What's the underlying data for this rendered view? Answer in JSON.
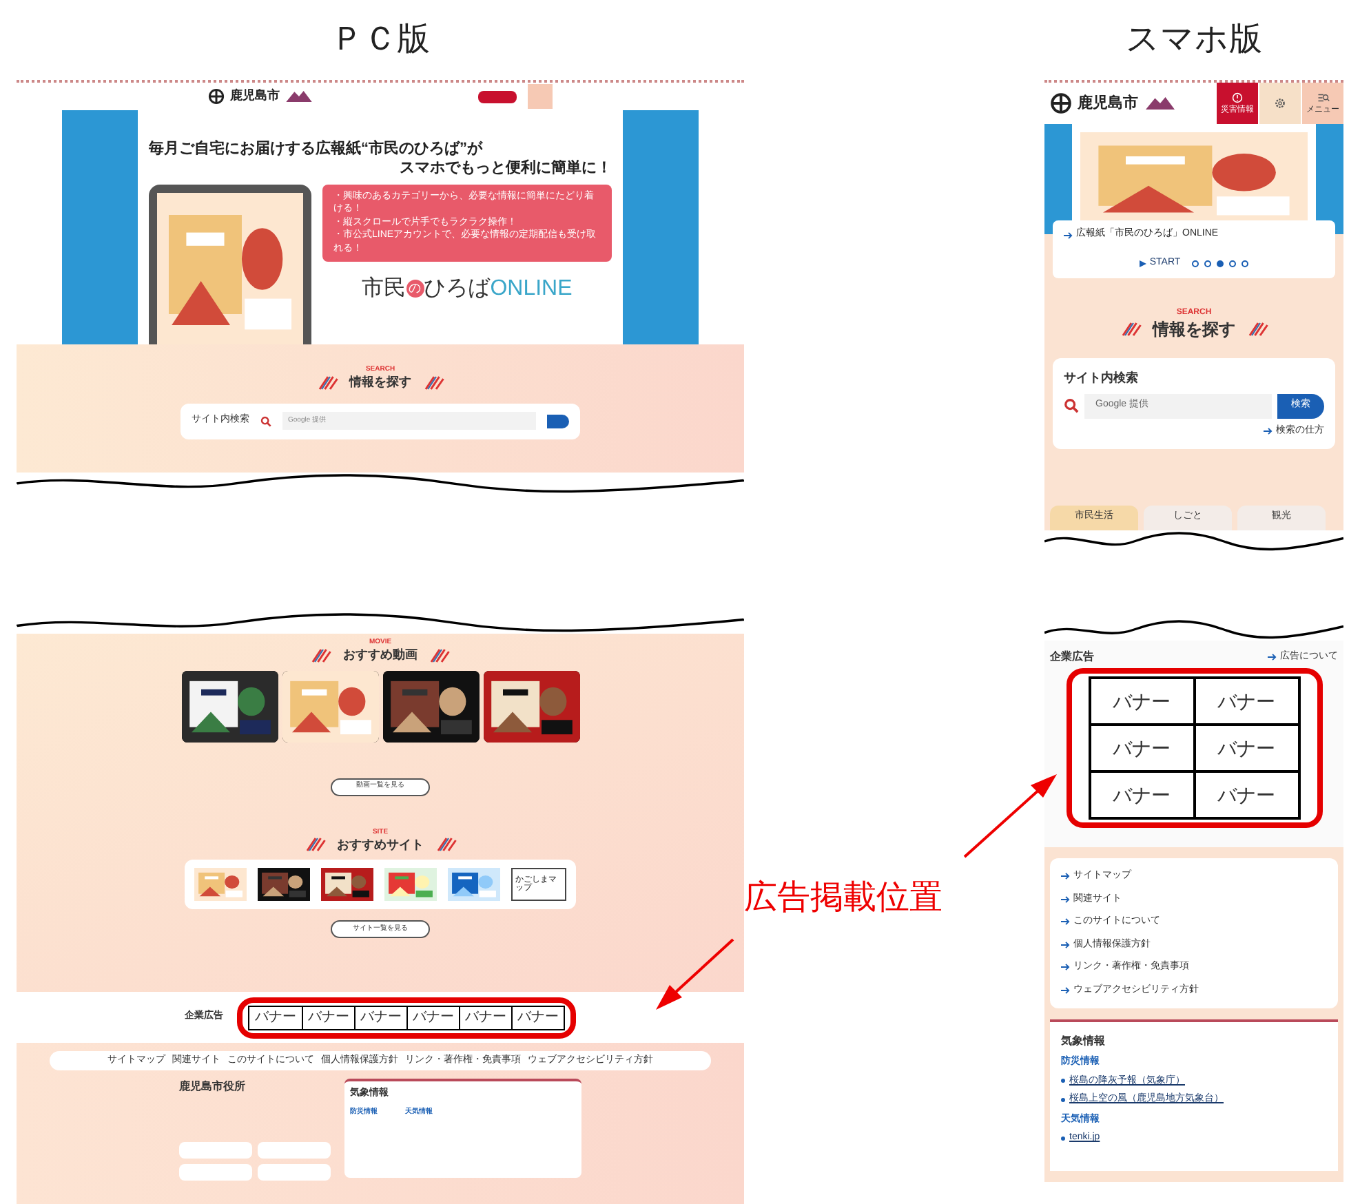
{
  "pc": {
    "label": "ＰＣ版",
    "header": {
      "logo": "鹿児島市"
    },
    "hero": {
      "headline": [
        "毎月ご自宅にお届けする広報紙“市民のひろば”が",
        "スマホでもっと便利に簡単に！"
      ],
      "bullets": [
        "・興味のあるカテゴリーから、必要な情報に簡単にたどり着ける！",
        "・縦スクロールで片手でもラクラク操作！",
        "・市公式LINEアカウントで、必要な情報の定期配信も受け取れる！"
      ],
      "brand": {
        "main": "市民",
        "circle": "の",
        "rest": "ひろば",
        "suffix": "ONLINE"
      }
    },
    "search": {
      "eyebrow": "SEARCH",
      "title": "情報を探す",
      "card_title": "サイト内検索",
      "placeholder": "Google 提供"
    },
    "movies": {
      "eyebrow": "MOVIE",
      "title": "おすすめ動画",
      "thumbnails": [
        {
          "kind": "picture"
        },
        {
          "kind": "picture"
        },
        {
          "kind": "picture"
        },
        {
          "kind": "picture"
        }
      ],
      "more": "動画一覧を見る"
    },
    "sites": {
      "eyebrow": "SITE",
      "title": "おすすめサイト",
      "banners": [
        {
          "kind": "picture"
        },
        {
          "kind": "picture"
        },
        {
          "kind": "picture"
        },
        {
          "kind": "picture"
        },
        {
          "kind": "picture"
        },
        {
          "kind": "map",
          "label": "かごしまマップ"
        }
      ],
      "more": "サイト一覧を見る"
    },
    "ads": {
      "title": "企業広告",
      "slots": [
        "バナー",
        "バナー",
        "バナー",
        "バナー",
        "バナー",
        "バナー"
      ]
    },
    "footer": {
      "links": [
        "サイトマップ",
        "関連サイト",
        "このサイトについて",
        "個人情報保護方針",
        "リンク・著作権・免責事項",
        "ウェブアクセシビリティ方針"
      ],
      "office": "鹿児島市役所",
      "weather": {
        "title": "気象情報",
        "sections": [
          "防災情報",
          "天気情報"
        ]
      }
    }
  },
  "phone": {
    "label": "スマホ版",
    "header": {
      "logo": "鹿児島市",
      "buttons": [
        {
          "kind": "alert",
          "label": "災害情報"
        },
        {
          "kind": "globe"
        },
        {
          "kind": "menu",
          "label": "メニュー"
        }
      ]
    },
    "hero": {
      "link": "広報紙「市民のひろば」ONLINE",
      "start": "START",
      "dots": [
        {
          "selected": false
        },
        {
          "selected": false
        },
        {
          "selected": true
        },
        {
          "selected": false
        },
        {
          "selected": false
        }
      ]
    },
    "search": {
      "eyebrow": "SEARCH",
      "title": "情報を探す",
      "card_title": "サイト内検索",
      "placeholder": "Google 提供",
      "button": "検索",
      "help": "検索の仕方"
    },
    "tabs": [
      {
        "label": "市民生活",
        "selected": true
      },
      {
        "label": "しごと",
        "selected": false
      },
      {
        "label": "観光",
        "selected": false
      }
    ],
    "ads": {
      "title": "企業広告",
      "about": "広告について",
      "slots": [
        "バナー",
        "バナー",
        "バナー",
        "バナー",
        "バナー",
        "バナー"
      ]
    },
    "footer": {
      "links": [
        "サイトマップ",
        "関連サイト",
        "このサイトについて",
        "個人情報保護方針",
        "リンク・著作権・免責事項",
        "ウェブアクセシビリティ方針"
      ]
    },
    "weather": {
      "title": "気象情報",
      "sections": [
        {
          "heading": "防災情報",
          "links": [
            "桜島の降灰予報（気象庁）",
            "桜島上空の風（鹿児島地方気象台）"
          ]
        },
        {
          "heading": "天気情報",
          "links": [
            "tenki.jp"
          ]
        }
      ]
    }
  },
  "annotation": {
    "label": "広告掲載位置"
  }
}
